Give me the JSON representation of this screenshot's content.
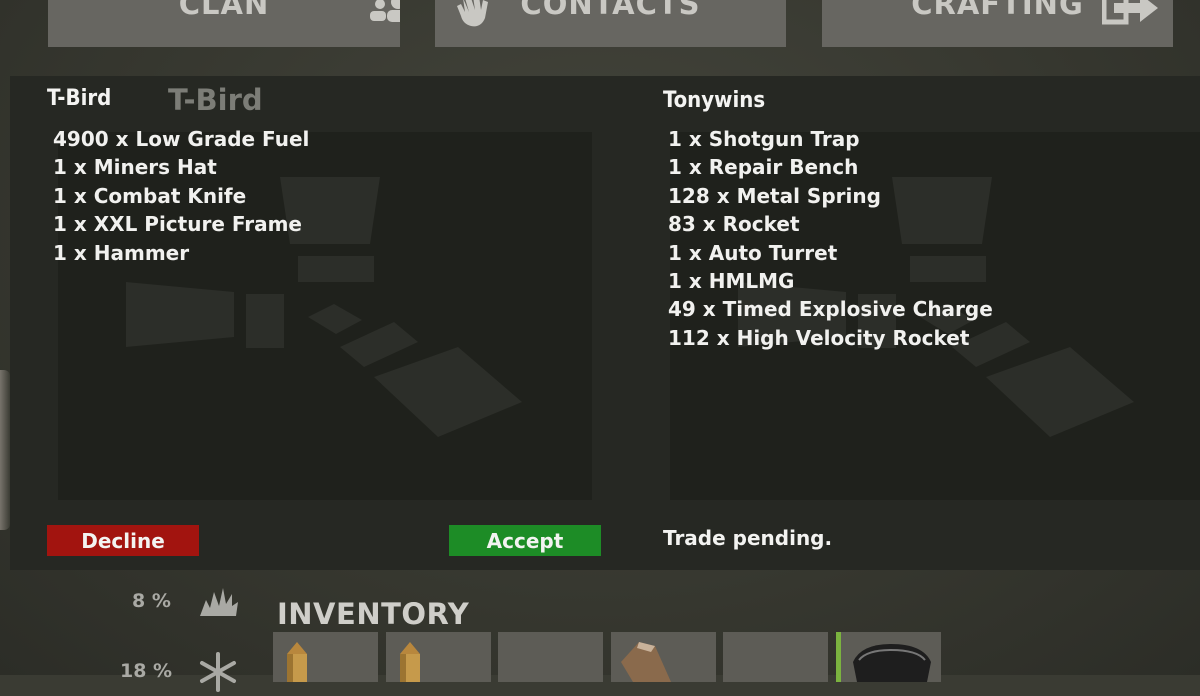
{
  "top_tabs": [
    {
      "label": "CLAN",
      "icon": "group-icon"
    },
    {
      "label": "CONTACTS",
      "icon": "wave-hand-icon"
    },
    {
      "label": "CRAFTING",
      "icon": "exit-arrow-icon"
    }
  ],
  "trade": {
    "left": {
      "name": "T-Bird",
      "ghost_name": "T-Bird",
      "items": [
        "4900 x Low Grade Fuel",
        "1 x Miners Hat",
        "1 x Combat Knife",
        "1 x XXL Picture Frame",
        "1 x Hammer"
      ]
    },
    "right": {
      "name": "Tonywins",
      "items": [
        "1 x Shotgun Trap",
        "1 x Repair Bench",
        "128 x Metal Spring",
        "83 x Rocket",
        "1 x Auto Turret",
        "1 x HMLMG",
        "49 x Timed Explosive Charge",
        "112 x High Velocity Rocket"
      ]
    },
    "decline_label": "Decline",
    "accept_label": "Accept",
    "status": "Trade pending."
  },
  "stats": [
    {
      "value": "8 %",
      "icon": "explosion-icon"
    },
    {
      "value": "18 %",
      "icon": "snowflake-icon"
    }
  ],
  "inventory": {
    "title": "INVENTORY",
    "slots": [
      "rifle-ammo-icon",
      "rifle-ammo-icon",
      "empty",
      "wood-item-icon",
      "empty",
      "goggles-icon"
    ]
  },
  "colors": {
    "decline": "#a2140f",
    "accept": "#1d8c26",
    "active_slot_marker": "#7bb33f"
  }
}
